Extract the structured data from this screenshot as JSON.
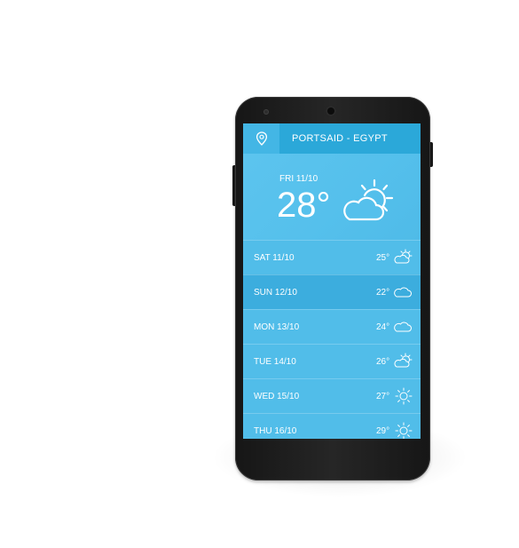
{
  "location": {
    "name": "PORTSAID - EGYPT",
    "icon": "location-pin-icon"
  },
  "current": {
    "date": "FRI  11/10",
    "temperature": "28°",
    "icon": "partly-sunny-icon"
  },
  "forecast": [
    {
      "day": "SAT 11/10",
      "temp": "25°",
      "icon": "partly-sunny-icon",
      "selected": false
    },
    {
      "day": "SUN 12/10",
      "temp": "22°",
      "icon": "cloud-icon",
      "selected": true
    },
    {
      "day": "MON 13/10",
      "temp": "24°",
      "icon": "cloud-icon",
      "selected": false
    },
    {
      "day": "TUE 14/10",
      "temp": "26°",
      "icon": "partly-sunny-icon",
      "selected": false
    },
    {
      "day": "WED 15/10",
      "temp": "27°",
      "icon": "sun-icon",
      "selected": false
    },
    {
      "day": "THU 16/10",
      "temp": "29°",
      "icon": "sun-icon",
      "selected": false
    }
  ],
  "colors": {
    "screen": "#51bde9",
    "header": "#2ba8d9",
    "selected_row": "#3cadde",
    "phone_body": "#1e1e1e"
  }
}
